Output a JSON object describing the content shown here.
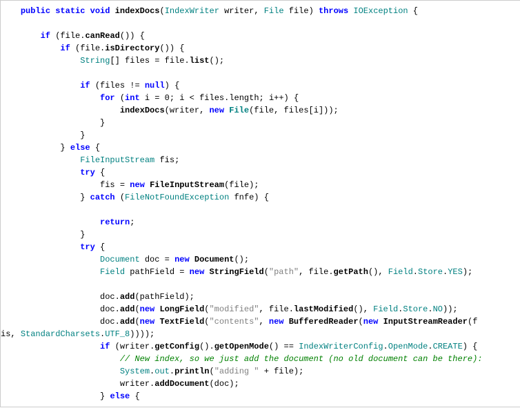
{
  "tokens": {
    "kw_public": "public",
    "kw_static": "static",
    "kw_void": "void",
    "kw_throws": "throws",
    "kw_if": "if",
    "kw_else": "else",
    "kw_for": "for",
    "kw_int": "int",
    "kw_try": "try",
    "kw_catch": "catch",
    "kw_return": "return",
    "kw_new": "new",
    "kw_null": "null",
    "t_indexDocs": "indexDocs",
    "t_IndexWriter": "IndexWriter",
    "t_File": "File",
    "t_IOException": "IOException",
    "t_FileNotFoundException": "FileNotFoundException",
    "t_Document": "Document",
    "t_Field": "Field",
    "t_FileInputStream": "FileInputStream",
    "t_StringField": "StringField",
    "t_LongField": "LongField",
    "t_TextField": "TextField",
    "t_BufferedReader": "BufferedReader",
    "t_InputStreamReader": "InputStreamReader",
    "t_IndexWriterConfig": "IndexWriterConfig",
    "t_OpenMode": "OpenMode",
    "m_canRead": "canRead",
    "m_isDirectory": "isDirectory",
    "m_list": "list",
    "m_length": "length",
    "m_getPath": "getPath",
    "m_add": "add",
    "m_lastModified": "lastModified",
    "m_getConfig": "getConfig",
    "m_getOpenMode": "getOpenMode",
    "m_println": "println",
    "m_addDocument": "addDocument",
    "v_writer": "writer",
    "v_file": "file",
    "v_files": "files",
    "v_i": "i",
    "v_fis": "fis",
    "v_fnfe": "fnfe",
    "v_doc": "doc",
    "v_pathField": "pathField",
    "v_f": "f",
    "v_String": "String",
    "v_Store": "Store",
    "v_YES": "YES",
    "v_NO": "NO",
    "v_System": "System",
    "v_out": "out",
    "v_CREATE": "CREATE",
    "v_is": "is",
    "v_StandardCharsets": "StandardCharsets",
    "v_UTF_8": "UTF_8",
    "s_path": "\"path\"",
    "s_modified": "\"modified\"",
    "s_contents": "\"contents\"",
    "s_adding": "\"adding \"",
    "n_0": "0",
    "comment1": "// New index, so we just add the document (no old document can be there):"
  }
}
